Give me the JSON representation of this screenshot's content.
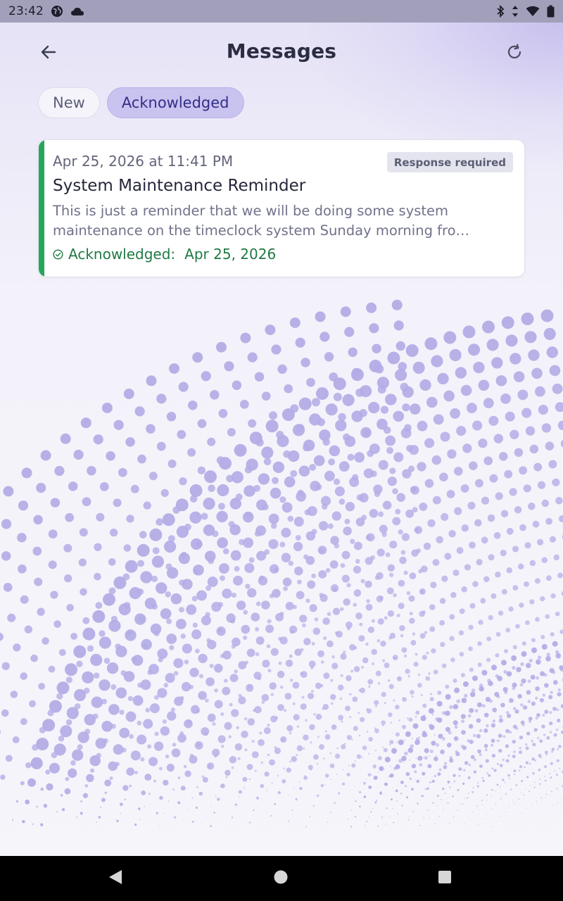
{
  "status_bar": {
    "time": "23:42",
    "left_icons": [
      "globe-icon",
      "cloud-icon"
    ],
    "right_icons": [
      "bluetooth-icon",
      "data-arrows-icon",
      "wifi-icon",
      "battery-icon"
    ]
  },
  "header": {
    "title": "Messages",
    "back_icon": "arrow-left-icon",
    "refresh_icon": "refresh-icon"
  },
  "tabs": [
    {
      "label": "New",
      "selected": false
    },
    {
      "label": "Acknowledged",
      "selected": true
    }
  ],
  "messages": [
    {
      "date": "Apr 25, 2026 at 11:41 PM",
      "badge": "Response required",
      "title": "System Maintenance Reminder",
      "preview": "This is just a reminder that we will be doing some system maintenance on the timeclock system Sunday morning fro…",
      "ack_label": "Acknowledged:",
      "ack_date": "Apr 25, 2026",
      "accent_color": "#26a65b"
    }
  ],
  "nav_bar": {
    "icons": [
      "nav-back-icon",
      "nav-home-icon",
      "nav-recents-icon"
    ]
  },
  "colors": {
    "accent": "#26a65b",
    "chip_selected": "#c9c3f0",
    "dot_pattern": "#b3ace6"
  }
}
